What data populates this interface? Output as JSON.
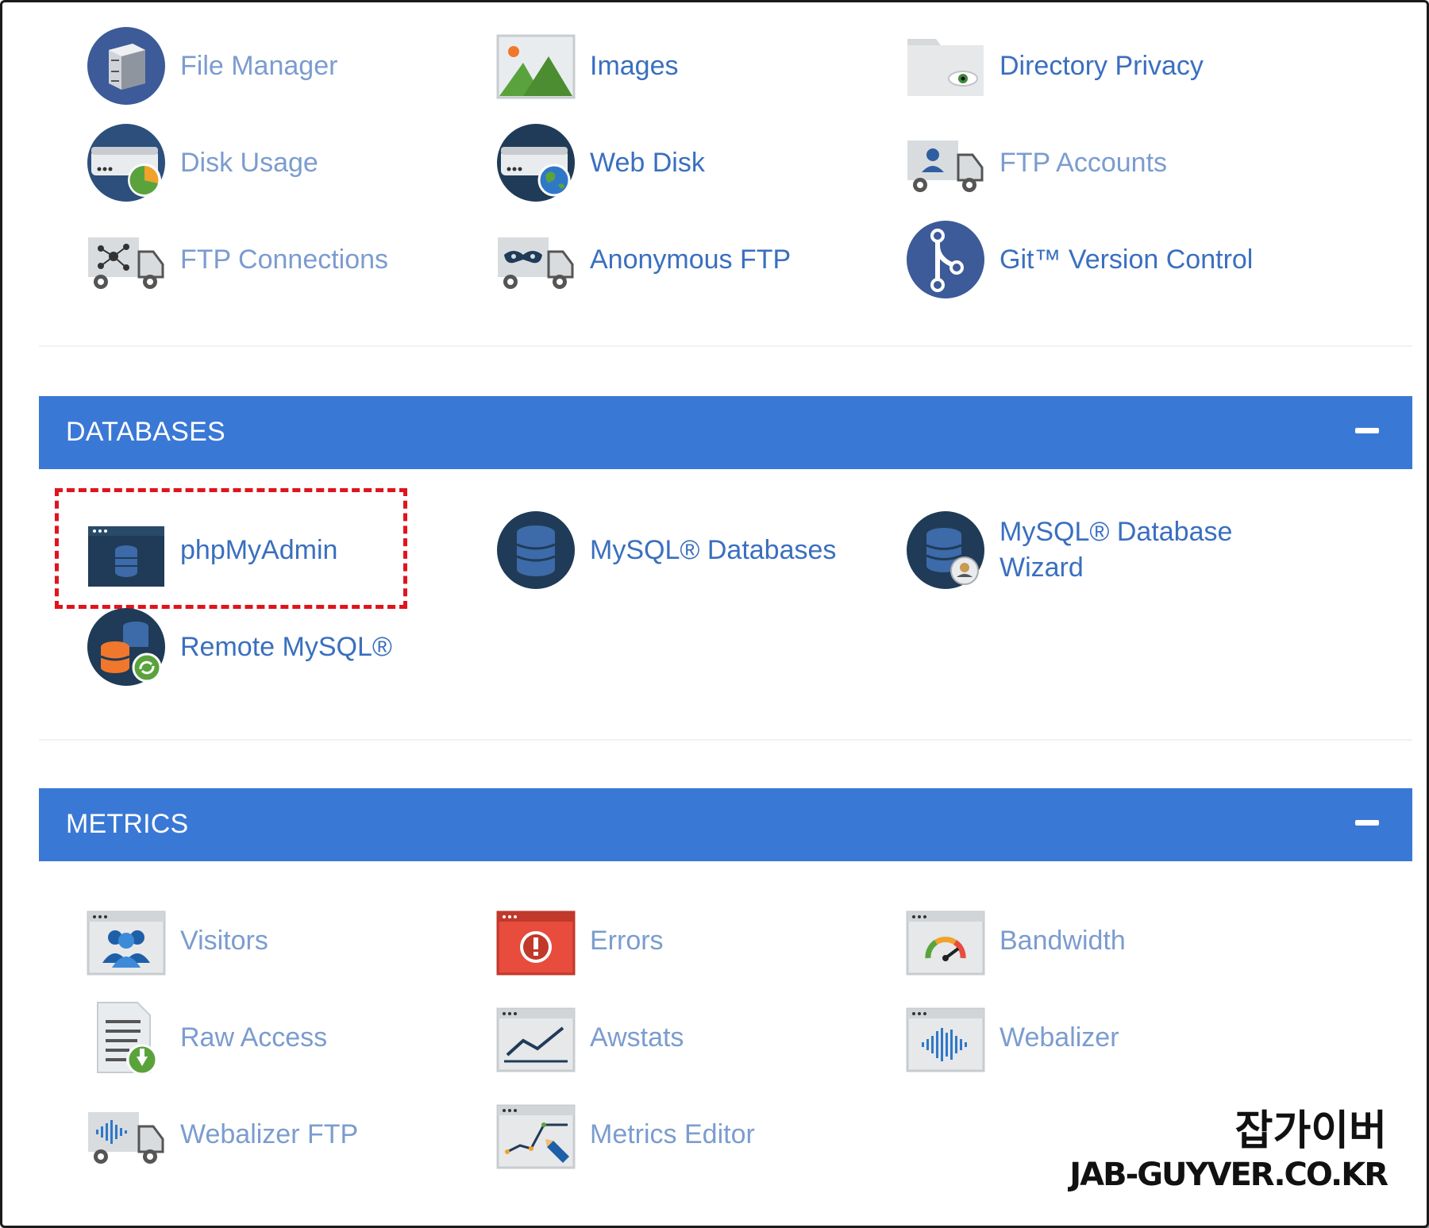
{
  "colors": {
    "section_header_bg": "#3a78d6",
    "link_text": "#3a6fbf",
    "highlight_border": "#e0141e",
    "icon_navy": "#1f3b57",
    "icon_blue": "#3d5a99",
    "icon_grey": "#d9dcdf"
  },
  "files": {
    "items": [
      {
        "label": "File Manager",
        "icon": "file-cabinet-icon"
      },
      {
        "label": "Images",
        "icon": "image-icon"
      },
      {
        "label": "Directory Privacy",
        "icon": "folder-eye-icon"
      },
      {
        "label": "Disk Usage",
        "icon": "disk-usage-icon"
      },
      {
        "label": "Web Disk",
        "icon": "web-disk-icon"
      },
      {
        "label": "FTP Accounts",
        "icon": "ftp-accounts-truck-icon"
      },
      {
        "label": "FTP Connections",
        "icon": "ftp-connections-truck-icon"
      },
      {
        "label": "Anonymous FTP",
        "icon": "anonymous-ftp-truck-icon"
      },
      {
        "label": "Git™ Version Control",
        "icon": "git-branch-icon"
      }
    ]
  },
  "databases": {
    "title": "DATABASES",
    "items": [
      {
        "label": "phpMyAdmin",
        "icon": "phpmyadmin-window-icon"
      },
      {
        "label": "MySQL® Databases",
        "icon": "database-stack-icon"
      },
      {
        "label": "MySQL® Database Wizard",
        "icon": "database-wizard-icon"
      },
      {
        "label": "Remote MySQL®",
        "icon": "remote-mysql-icon"
      }
    ]
  },
  "metrics": {
    "title": "METRICS",
    "items": [
      {
        "label": "Visitors",
        "icon": "visitors-icon"
      },
      {
        "label": "Errors",
        "icon": "errors-alert-icon"
      },
      {
        "label": "Bandwidth",
        "icon": "bandwidth-gauge-icon"
      },
      {
        "label": "Raw Access",
        "icon": "raw-access-download-icon"
      },
      {
        "label": "Awstats",
        "icon": "awstats-chart-icon"
      },
      {
        "label": "Webalizer",
        "icon": "webalizer-waveform-icon"
      },
      {
        "label": "Webalizer FTP",
        "icon": "webalizer-ftp-truck-icon"
      },
      {
        "label": "Metrics Editor",
        "icon": "metrics-editor-icon"
      }
    ]
  },
  "watermark": {
    "line1": "잡가이버",
    "line2": "JAB-GUYVER.CO.KR"
  }
}
